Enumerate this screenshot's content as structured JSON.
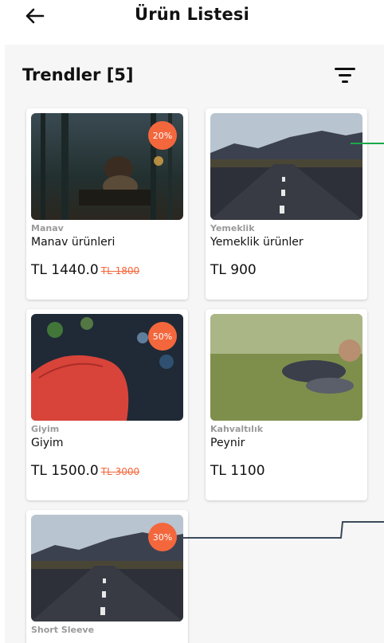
{
  "appbar": {
    "title": "Ürün Listesi"
  },
  "section": {
    "title": "Trendler [5]"
  },
  "products": [
    {
      "category": "Manav",
      "name": "Manav ürünleri",
      "price": "TL 1440.0",
      "old_price": "TL 1800",
      "discount": "20%"
    },
    {
      "category": "Yemeklik",
      "name": "Yemeklik ürünler",
      "price": "TL 900"
    },
    {
      "category": "Giyim",
      "name": "Giyim",
      "price": "TL 1500.0",
      "old_price": "TL 3000",
      "discount": "50%"
    },
    {
      "category": "Kahvaltılık",
      "name": "Peynir",
      "price": "TL 1100"
    },
    {
      "category": "Short Sleeve",
      "discount": "30%"
    }
  ],
  "colors": {
    "accent": "#f4673d",
    "annotation_green": "#1aa84a",
    "annotation_dark": "#3b4a5a"
  }
}
